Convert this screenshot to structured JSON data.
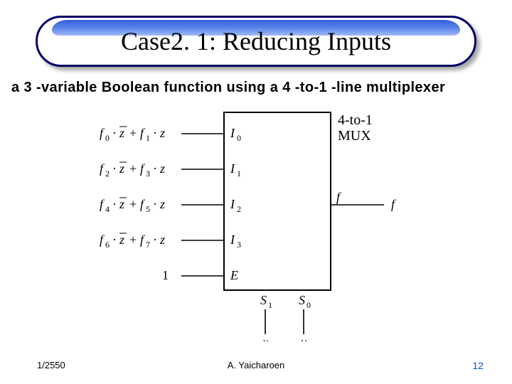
{
  "title": "Case2. 1: Reducing Inputs",
  "subtitle": "a 3 -variable Boolean function using a 4 -to-1 -line multiplexer",
  "diagram": {
    "box_label_top": "4-to-1",
    "box_label_bottom": "MUX",
    "inputs": [
      {
        "expr_a": "f",
        "expr_a_sub": "0",
        "expr_b": "f",
        "expr_b_sub": "1",
        "var": "z",
        "pin": "I",
        "pin_sub": "0"
      },
      {
        "expr_a": "f",
        "expr_a_sub": "2",
        "expr_b": "f",
        "expr_b_sub": "3",
        "var": "z",
        "pin": "I",
        "pin_sub": "1"
      },
      {
        "expr_a": "f",
        "expr_a_sub": "4",
        "expr_b": "f",
        "expr_b_sub": "5",
        "var": "z",
        "pin": "I",
        "pin_sub": "2"
      },
      {
        "expr_a": "f",
        "expr_a_sub": "6",
        "expr_b": "f",
        "expr_b_sub": "7",
        "var": "z",
        "pin": "I",
        "pin_sub": "3"
      }
    ],
    "enable_value": "1",
    "enable_pin": "E",
    "selects": [
      {
        "pin": "S",
        "pin_sub": "1",
        "label": "x"
      },
      {
        "pin": "S",
        "pin_sub": "0",
        "label": "y"
      }
    ],
    "output_pin": "f",
    "output_label": "f"
  },
  "footer": {
    "left": "1/2550",
    "center": "A. Yaicharoen",
    "right": "12"
  }
}
